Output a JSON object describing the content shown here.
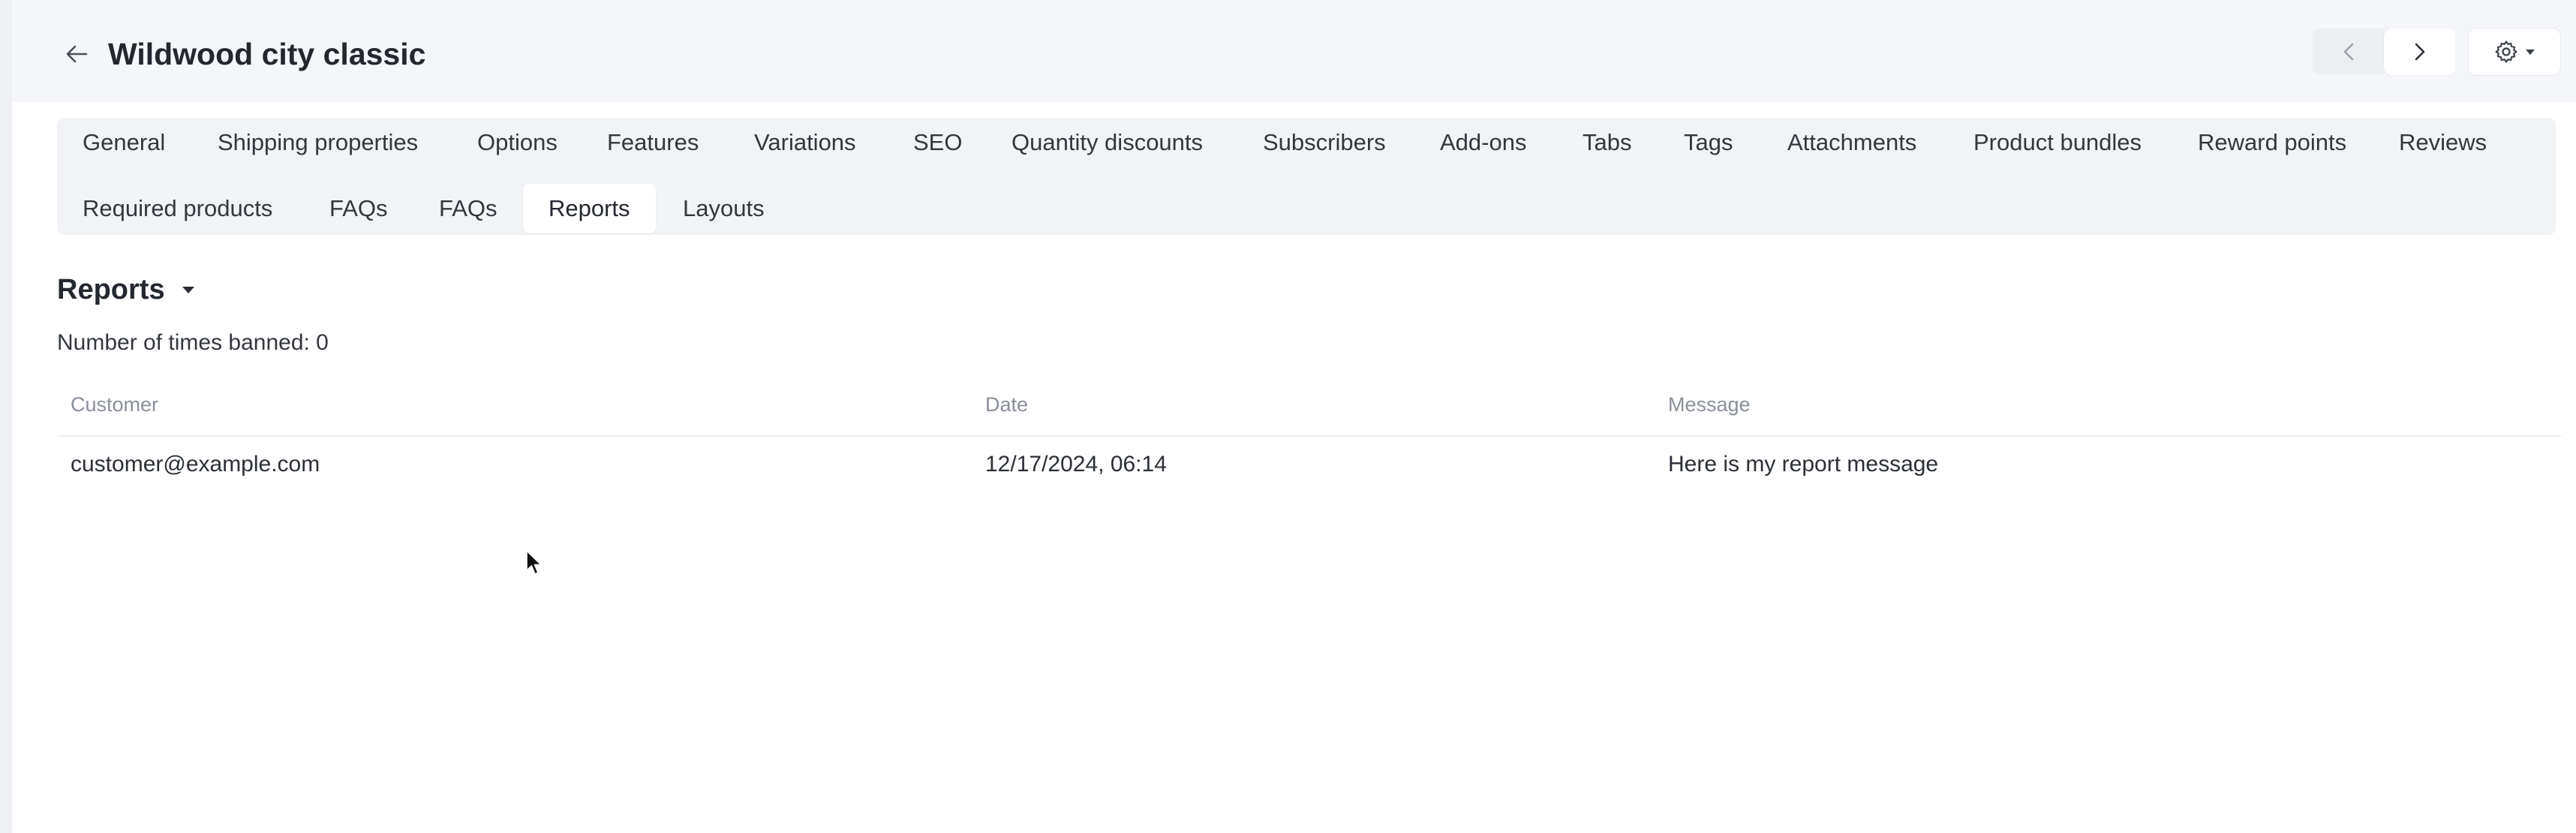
{
  "header": {
    "title": "Wildwood city classic"
  },
  "tabs": [
    {
      "label": "General",
      "active": false
    },
    {
      "label": "Shipping properties",
      "active": false
    },
    {
      "label": "Options",
      "active": false
    },
    {
      "label": "Features",
      "active": false
    },
    {
      "label": "Variations",
      "active": false
    },
    {
      "label": "SEO",
      "active": false
    },
    {
      "label": "Quantity discounts",
      "active": false
    },
    {
      "label": "Subscribers",
      "active": false
    },
    {
      "label": "Add-ons",
      "active": false
    },
    {
      "label": "Tabs",
      "active": false
    },
    {
      "label": "Tags",
      "active": false
    },
    {
      "label": "Attachments",
      "active": false
    },
    {
      "label": "Product bundles",
      "active": false
    },
    {
      "label": "Reward points",
      "active": false
    },
    {
      "label": "Reviews",
      "active": false
    },
    {
      "label": "Required products",
      "active": false
    },
    {
      "label": "FAQs",
      "active": false
    },
    {
      "label": "FAQs",
      "active": false
    },
    {
      "label": "Reports",
      "active": true
    },
    {
      "label": "Layouts",
      "active": false
    }
  ],
  "section": {
    "title": "Reports",
    "banned_text": "Number of times banned: 0"
  },
  "table": {
    "headers": {
      "customer": "Customer",
      "date": "Date",
      "message": "Message"
    },
    "rows": [
      {
        "customer": "customer@example.com",
        "date": "12/17/2024, 06:14",
        "message": "Here is my report message"
      }
    ]
  },
  "icons": {
    "back": "arrow-left-icon",
    "prev": "chevron-left-icon",
    "next": "chevron-right-icon",
    "settings": "gear-icon",
    "dropdown": "caret-down-icon"
  },
  "colors": {
    "header_bg": "#f4f6f9",
    "tabs_bg": "#f1f3f6",
    "active_tab_bg": "#ffffff",
    "text": "#23272e",
    "muted": "#8a9099"
  }
}
